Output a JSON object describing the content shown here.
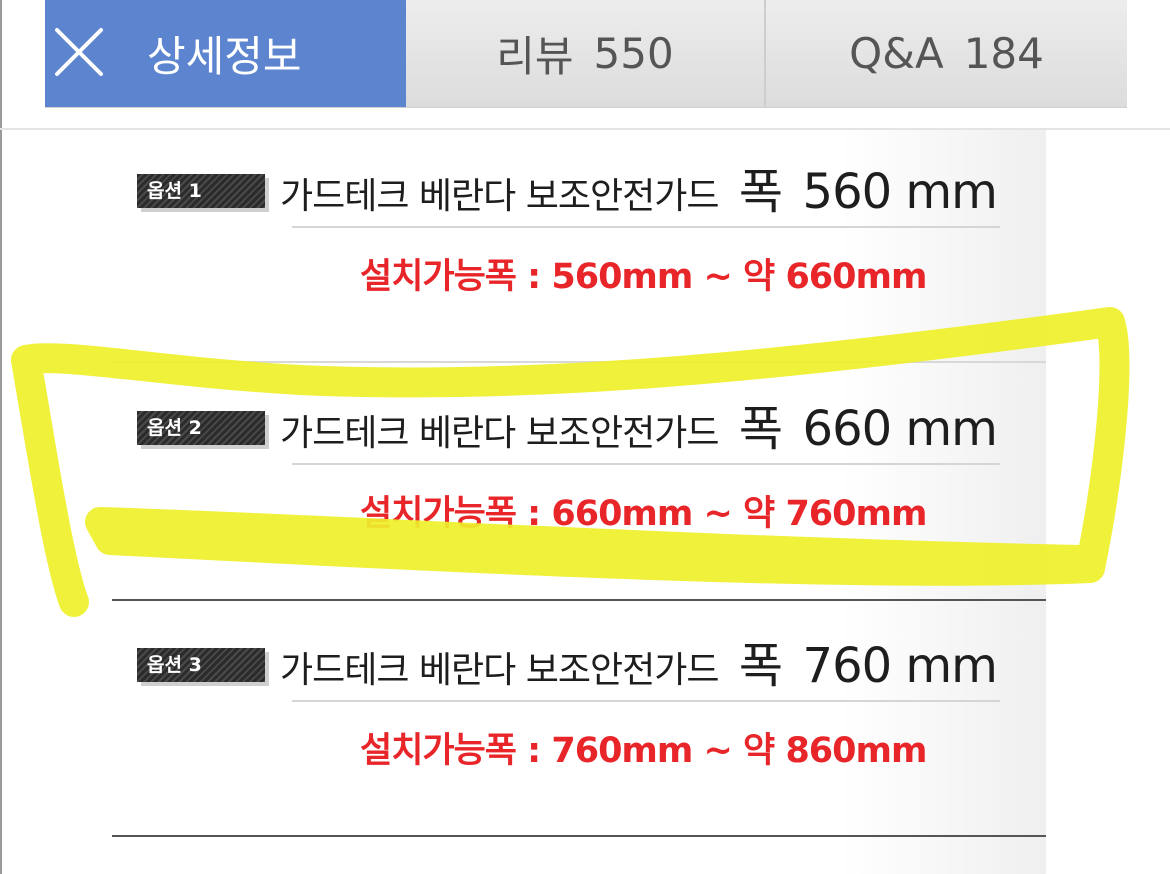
{
  "tabs": [
    {
      "label": "상세정보",
      "active": true
    },
    {
      "label": "리뷰",
      "count": "550",
      "active": false
    },
    {
      "label": "Q&A",
      "count": "184",
      "active": false
    }
  ],
  "options": [
    {
      "badge": "옵션 1",
      "title": "가드테크 베란다 보조안전가드",
      "width_label": "폭",
      "width_value": "560 mm",
      "range": "설치가능폭 : 560mm ~ 약 660mm"
    },
    {
      "badge": "옵션 2",
      "title": "가드테크 베란다 보조안전가드",
      "width_label": "폭",
      "width_value": "660 mm",
      "range": "설치가능폭 : 660mm ~ 약 760mm"
    },
    {
      "badge": "옵션 3",
      "title": "가드테크 베란다 보조안전가드",
      "width_label": "폭",
      "width_value": "760 mm",
      "range": "설치가능폭 : 760mm ~ 약 860mm"
    }
  ],
  "colors": {
    "active_tab": "#5c84cf",
    "range_text": "#e8262a",
    "highlight": "#eef02a"
  },
  "icons": {
    "close": "close-icon"
  }
}
